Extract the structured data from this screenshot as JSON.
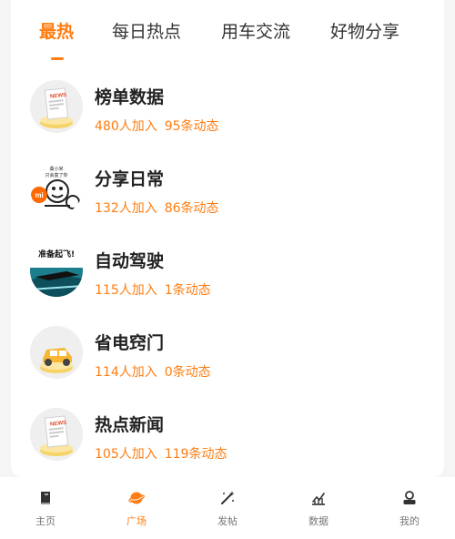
{
  "tabs": [
    {
      "label": "最热",
      "active": true
    },
    {
      "label": "每日热点",
      "active": false
    },
    {
      "label": "用车交流",
      "active": false
    },
    {
      "label": "好物分享",
      "active": false
    }
  ],
  "groups": [
    {
      "title": "榜单数据",
      "joined": "480人加入",
      "posts": "95条动态",
      "icon": "newspaper-icon",
      "avatar_text": "NEWS"
    },
    {
      "title": "分享日常",
      "joined": "132人加入",
      "posts": "86条动态",
      "icon": "cartoon-driver-icon",
      "avatar_text": [
        "桑小米",
        "只会富了你"
      ]
    },
    {
      "title": "自动驾驶",
      "joined": "115人加入",
      "posts": "1条动态",
      "icon": "car-road-icon",
      "avatar_text": "准备起飞!"
    },
    {
      "title": "省电窍门",
      "joined": "114人加入",
      "posts": "0条动态",
      "icon": "yellow-car-icon"
    },
    {
      "title": "热点新闻",
      "joined": "105人加入",
      "posts": "119条动态",
      "icon": "newspaper-icon",
      "avatar_text": "NEWS"
    }
  ],
  "bottom_nav": [
    {
      "label": "主页",
      "icon": "book-icon",
      "active": false
    },
    {
      "label": "广场",
      "icon": "planet-icon",
      "active": true
    },
    {
      "label": "发帖",
      "icon": "magic-wand-icon",
      "active": false
    },
    {
      "label": "数据",
      "icon": "chart-icon",
      "active": false
    },
    {
      "label": "我的",
      "icon": "user-icon",
      "active": false
    }
  ],
  "colors": {
    "accent": "#ff7d12",
    "text": "#222222",
    "muted": "#777777",
    "background": "#f5f5f5"
  }
}
